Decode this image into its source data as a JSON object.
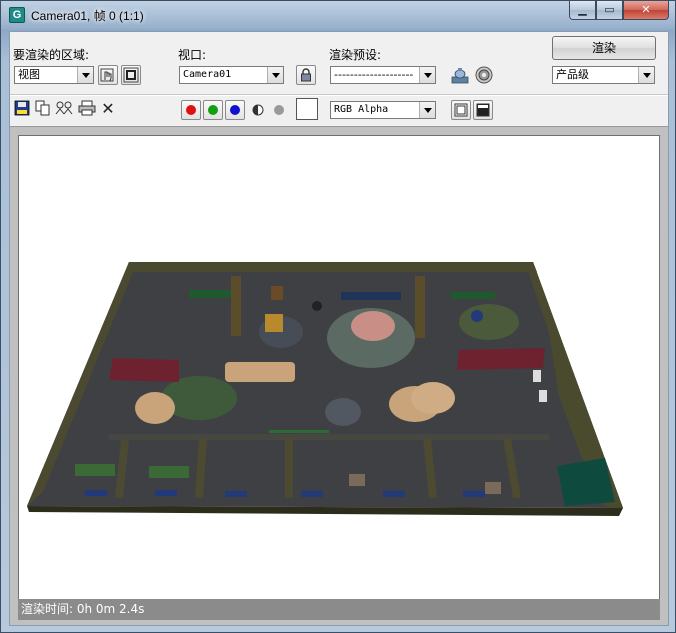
{
  "window": {
    "title": "Camera01, 帧 0 (1:1)",
    "app_icon_letter": "G",
    "controls": [
      "minimize-icon",
      "maximize-icon",
      "close-icon"
    ]
  },
  "toolbar_top": {
    "area_label": "要渲染的区域:",
    "area_value": "视图",
    "viewport_label": "视口:",
    "viewport_value": "Camera01",
    "preset_label": "渲染预设:",
    "preset_value": "--------------------",
    "render_button": "渲染",
    "quality_value": "产品级"
  },
  "toolbar_bottom": {
    "channel_value": "RGB Alpha",
    "channels": [
      {
        "name": "red-channel",
        "color": "#e01010"
      },
      {
        "name": "green-channel",
        "color": "#10a010"
      },
      {
        "name": "blue-channel",
        "color": "#1010d0"
      }
    ]
  },
  "status": {
    "render_time": "渲染时间: 0h 0m 2.4s"
  },
  "colors": {
    "floor": "#3e4044",
    "wall": "#4a4a2e",
    "wall_dark": "#2d2d1b",
    "rug_pink": "#c98f86",
    "table_wood": "#c9a37a",
    "sofa_red": "#6e2230",
    "teal_panel": "#0f4a3f"
  }
}
